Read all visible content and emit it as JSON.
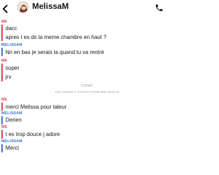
{
  "header": {
    "contact_name": "MelissaM"
  },
  "icons": {
    "back": "chevron-left-icon",
    "call": "phone-icon",
    "avatar": "bitmoji-avatar"
  },
  "colors": {
    "me": "#e8384f",
    "other": "#3a6bd6"
  },
  "conversation": {
    "messages": [
      {
        "sender": "ME",
        "text": "dacc"
      },
      {
        "sender": "ME",
        "text": "apres t es ds la meme chambre en haut ?"
      },
      {
        "sender": "MELISSAM",
        "text": "Nn en bas je serais la quand tu va rentré"
      },
      {
        "sender": "ME",
        "text": "super"
      },
      {
        "sender": "ME",
        "text": "jrv"
      },
      {
        "sender": "ME",
        "text": "merci Melissa pour taleur"
      },
      {
        "sender": "MELISSAM",
        "text": "Derien"
      },
      {
        "sender": "ME",
        "text": "t es trop douce j adore"
      },
      {
        "sender": "MELISSAM",
        "text": "Merci"
      }
    ],
    "date_separator": "TODAY",
    "system_note": "YOU SAVED A PHOTO FROM MELISSA M"
  }
}
